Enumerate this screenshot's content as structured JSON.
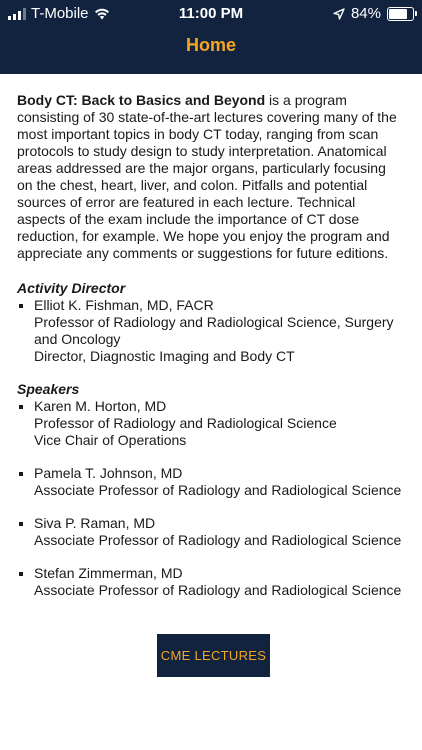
{
  "status_bar": {
    "carrier": "T-Mobile",
    "time": "11:00 PM",
    "battery": "84%",
    "battery_level": 0.84,
    "icons": [
      "signal-icon",
      "wifi-icon",
      "location-arrow-icon",
      "battery-icon"
    ]
  },
  "header": {
    "title": "Home"
  },
  "intro": {
    "program_name": "Body CT: Back to Basics and Beyond",
    "text": " is a program consisting of 30 state-of-the-art lectures covering many of the most important topics in body CT today, ranging from scan protocols to study design to study interpretation. Anatomical areas addressed are the major organs, particularly focusing on the chest, heart, liver, and colon. Pitfalls and potential sources of error are featured in each lecture. Technical aspects of the exam include the importance of CT dose reduction, for example. We hope you enjoy the program and appreciate any comments or suggestions for future editions."
  },
  "activity_director": {
    "heading": "Activity Director",
    "people": [
      {
        "name": "Elliot K. Fishman, MD, FACR",
        "line1": "Professor of Radiology and Radiological Science, Surgery and Oncology",
        "line2": "Director, Diagnostic Imaging and Body CT"
      }
    ]
  },
  "speakers": {
    "heading": "Speakers",
    "people": [
      {
        "name": "Karen M. Horton, MD",
        "line1": "Professor of Radiology and Radiological Science",
        "line2": "Vice Chair of Operations"
      },
      {
        "name": "Pamela T. Johnson, MD",
        "line1": "Associate Professor of Radiology and Radiological Science"
      },
      {
        "name": "Siva P. Raman, MD",
        "line1": "Associate Professor of Radiology and Radiological Science"
      },
      {
        "name": "Stefan Zimmerman, MD",
        "line1": "Associate Professor of Radiology and Radiological Science"
      }
    ]
  },
  "logo": {
    "text": "CME LECTURES"
  },
  "colors": {
    "navy": "#122340",
    "accent": "#f5a623"
  }
}
